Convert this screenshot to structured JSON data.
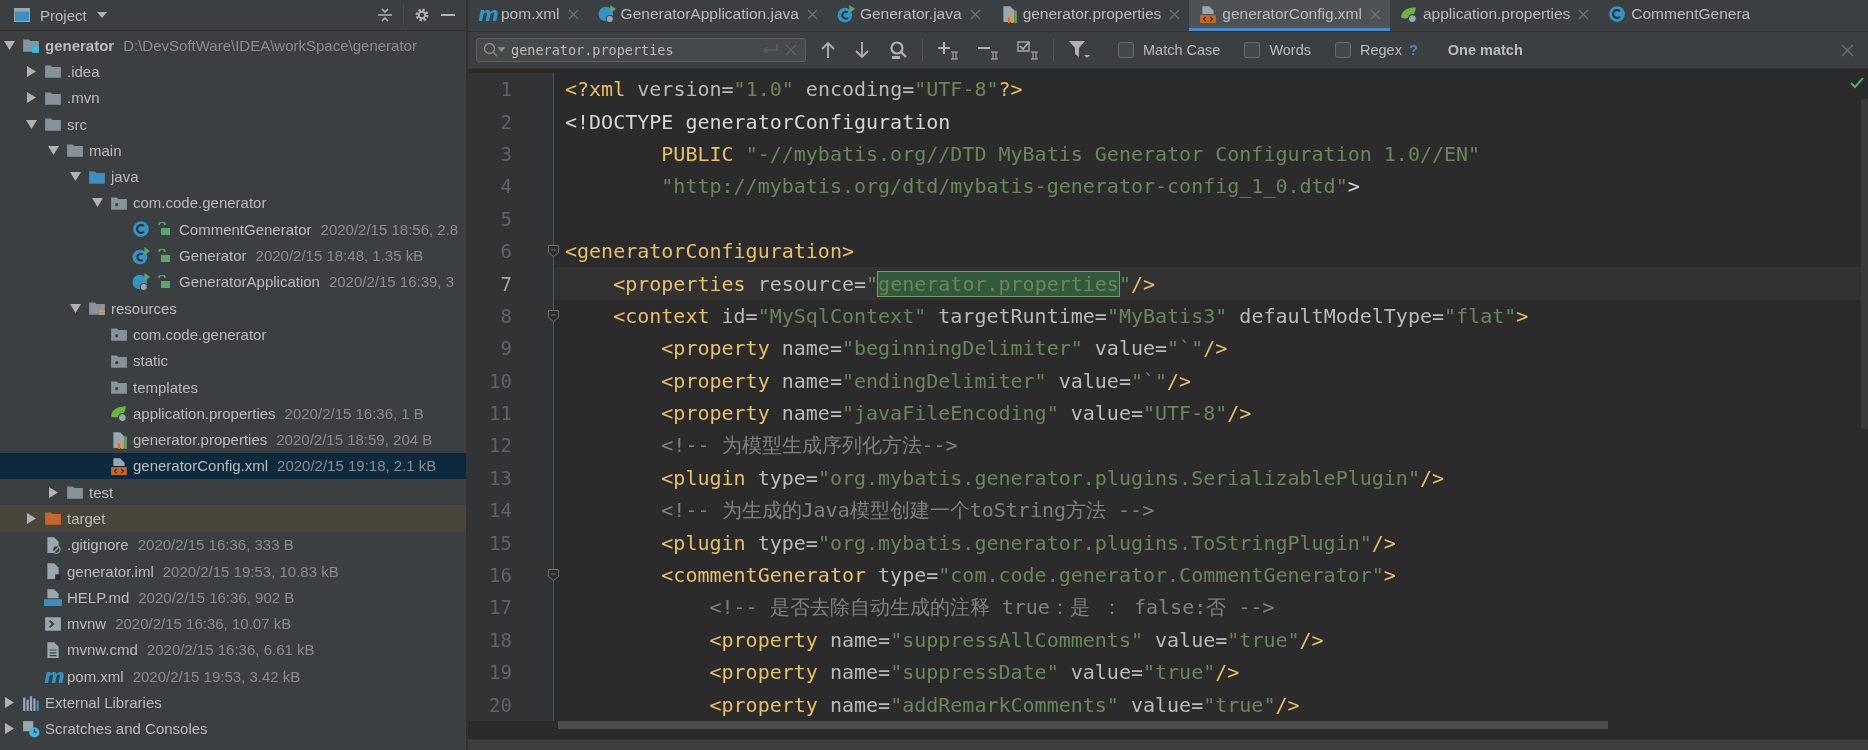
{
  "project_panel": {
    "title": "Project",
    "tree": [
      {
        "name": "generator",
        "meta": "D:\\DevSoftWare\\IDEA\\workSpace\\generator",
        "kind": "module",
        "expanded": true,
        "selected": false,
        "children": [
          {
            "name": ".idea",
            "kind": "folder",
            "expanded": false,
            "selected": false
          },
          {
            "name": ".mvn",
            "kind": "folder",
            "expanded": false,
            "selected": false
          },
          {
            "name": "src",
            "kind": "folder",
            "expanded": true,
            "selected": false,
            "children": [
              {
                "name": "main",
                "kind": "folder",
                "expanded": true,
                "selected": false,
                "children": [
                  {
                    "name": "java",
                    "kind": "source-folder",
                    "expanded": true,
                    "selected": false,
                    "children": [
                      {
                        "name": "com.code.generator",
                        "kind": "package",
                        "expanded": true,
                        "selected": false,
                        "children": [
                          {
                            "name": "CommentGenerator",
                            "meta": "2020/2/15 18:56, 2.8",
                            "kind": "class",
                            "lock": true,
                            "selected": false
                          },
                          {
                            "name": "Generator",
                            "meta": "2020/2/15 18:48, 1.35 kB",
                            "kind": "class-runnable",
                            "lock": true,
                            "selected": false
                          },
                          {
                            "name": "GeneratorApplication",
                            "meta": "2020/2/15 16:39, 3",
                            "kind": "class-spring",
                            "lock": true,
                            "selected": false
                          }
                        ]
                      }
                    ]
                  },
                  {
                    "name": "resources",
                    "kind": "resources-folder",
                    "expanded": true,
                    "selected": false,
                    "children": [
                      {
                        "name": "com.code.generator",
                        "kind": "package",
                        "selected": false
                      },
                      {
                        "name": "static",
                        "kind": "package",
                        "selected": false
                      },
                      {
                        "name": "templates",
                        "kind": "package",
                        "selected": false
                      },
                      {
                        "name": "application.properties",
                        "meta": "2020/2/15 16:36, 1 B",
                        "kind": "spring-properties",
                        "selected": false
                      },
                      {
                        "name": "generator.properties",
                        "meta": "2020/2/15 18:59, 204 B",
                        "kind": "properties",
                        "selected": false
                      },
                      {
                        "name": "generatorConfig.xml",
                        "meta": "2020/2/15 19:18, 2.1 kB",
                        "kind": "xml",
                        "selected": true
                      }
                    ]
                  }
                ]
              },
              {
                "name": "test",
                "kind": "folder",
                "expanded": false,
                "selected": false
              }
            ]
          },
          {
            "name": "target",
            "kind": "excluded-folder",
            "expanded": false,
            "selected": false
          },
          {
            "name": ".gitignore",
            "meta": "2020/2/15 16:36, 333 B",
            "kind": "gitignore",
            "selected": false
          },
          {
            "name": "generator.iml",
            "meta": "2020/2/15 19:53, 10.83 kB",
            "kind": "iml",
            "selected": false
          },
          {
            "name": "HELP.md",
            "meta": "2020/2/15 16:36, 902 B",
            "kind": "markdown",
            "selected": false
          },
          {
            "name": "mvnw",
            "meta": "2020/2/15 16:36, 10.07 kB",
            "kind": "shell",
            "selected": false
          },
          {
            "name": "mvnw.cmd",
            "meta": "2020/2/15 16:36, 6.61 kB",
            "kind": "text-file",
            "selected": false
          },
          {
            "name": "pom.xml",
            "meta": "2020/2/15 19:53, 3.42 kB",
            "kind": "maven",
            "icon_text": "m",
            "selected": false
          }
        ]
      },
      {
        "name": "External Libraries",
        "kind": "libraries",
        "expanded": false,
        "selected": false
      },
      {
        "name": "Scratches and Consoles",
        "kind": "scratches",
        "expanded": false,
        "selected": false
      }
    ]
  },
  "editor": {
    "tabs": [
      {
        "label": "pom.xml",
        "kind": "maven",
        "icon_text": "m",
        "selected": false,
        "closable": true
      },
      {
        "label": "GeneratorApplication.java",
        "kind": "class-spring",
        "selected": false,
        "closable": true
      },
      {
        "label": "Generator.java",
        "kind": "class-runnable",
        "selected": false,
        "closable": true
      },
      {
        "label": "generator.properties",
        "kind": "properties",
        "selected": false,
        "closable": true
      },
      {
        "label": "generatorConfig.xml",
        "kind": "xml",
        "selected": true,
        "closable": true
      },
      {
        "label": "application.properties",
        "kind": "spring-properties",
        "selected": false,
        "closable": true
      },
      {
        "label": "CommentGenera",
        "kind": "class",
        "selected": false,
        "closable": false
      }
    ],
    "search": {
      "value": "generator.properties",
      "options": [
        {
          "label": "Match Case",
          "checked": false
        },
        {
          "label": "Words",
          "checked": false
        },
        {
          "label": "Regex",
          "checked": false
        }
      ],
      "help": "?",
      "status": "One match"
    },
    "lines": [
      {
        "number": "1",
        "fold": false,
        "current": false,
        "tokens": [
          {
            "kind": "tag",
            "text": "<?xml"
          },
          {
            "kind": "attr",
            "text": " version="
          },
          {
            "kind": "string",
            "text": "\"1.0\""
          },
          {
            "kind": "attr",
            "text": " encoding="
          },
          {
            "kind": "string",
            "text": "\"UTF-8\""
          },
          {
            "kind": "tag",
            "text": "?>"
          }
        ]
      },
      {
        "number": "2",
        "fold": false,
        "current": false,
        "tokens": [
          {
            "kind": "plain",
            "text": "<!DOCTYPE generatorConfiguration"
          }
        ]
      },
      {
        "number": "3",
        "fold": false,
        "current": false,
        "tokens": [
          {
            "kind": "tag",
            "text": "        PUBLIC "
          },
          {
            "kind": "string",
            "text": "\"-//mybatis.org//DTD MyBatis Generator Configuration 1.0//EN\""
          }
        ]
      },
      {
        "number": "4",
        "fold": false,
        "current": false,
        "tokens": [
          {
            "kind": "string",
            "text": "        \"http://mybatis.org/dtd/mybatis-generator-config_1_0.dtd\""
          },
          {
            "kind": "plain",
            "text": ">"
          }
        ]
      },
      {
        "number": "5",
        "fold": false,
        "current": false
      },
      {
        "number": "6",
        "fold": true,
        "current": false,
        "tokens": [
          {
            "kind": "tag",
            "text": "<generatorConfiguration>"
          }
        ]
      },
      {
        "number": "7",
        "fold": false,
        "current": true,
        "tokens": [
          {
            "kind": "tag",
            "text": "    <properties"
          },
          {
            "kind": "attr",
            "text": " resource="
          },
          {
            "kind": "string",
            "text": "\""
          },
          {
            "kind": "match",
            "text": "generator.properties"
          },
          {
            "kind": "string",
            "text": "\""
          },
          {
            "kind": "tag",
            "text": "/>"
          }
        ]
      },
      {
        "number": "8",
        "fold": true,
        "current": false,
        "tokens": [
          {
            "kind": "tag",
            "text": "    <context"
          },
          {
            "kind": "attr",
            "text": " id="
          },
          {
            "kind": "string",
            "text": "\"MySqlContext\""
          },
          {
            "kind": "attr",
            "text": " targetRuntime="
          },
          {
            "kind": "string",
            "text": "\"MyBatis3\""
          },
          {
            "kind": "attr",
            "text": " defaultModelType="
          },
          {
            "kind": "string",
            "text": "\"flat\""
          },
          {
            "kind": "tag",
            "text": ">"
          }
        ]
      },
      {
        "number": "9",
        "fold": false,
        "current": false,
        "tokens": [
          {
            "kind": "tag",
            "text": "        <property"
          },
          {
            "kind": "attr",
            "text": " name="
          },
          {
            "kind": "string",
            "text": "\"beginningDelimiter\""
          },
          {
            "kind": "attr",
            "text": " value="
          },
          {
            "kind": "string",
            "text": "\"`\""
          },
          {
            "kind": "tag",
            "text": "/>"
          }
        ]
      },
      {
        "number": "10",
        "fold": false,
        "current": false,
        "tokens": [
          {
            "kind": "tag",
            "text": "        <property"
          },
          {
            "kind": "attr",
            "text": " name="
          },
          {
            "kind": "string",
            "text": "\"endingDelimiter\""
          },
          {
            "kind": "attr",
            "text": " value="
          },
          {
            "kind": "string",
            "text": "\"`\""
          },
          {
            "kind": "tag",
            "text": "/>"
          }
        ]
      },
      {
        "number": "11",
        "fold": false,
        "current": false,
        "tokens": [
          {
            "kind": "tag",
            "text": "        <property"
          },
          {
            "kind": "attr",
            "text": " name="
          },
          {
            "kind": "string",
            "text": "\"javaFileEncoding\""
          },
          {
            "kind": "attr",
            "text": " value="
          },
          {
            "kind": "string",
            "text": "\"UTF-8\""
          },
          {
            "kind": "tag",
            "text": "/>"
          }
        ]
      },
      {
        "number": "12",
        "fold": false,
        "current": false,
        "tokens": [
          {
            "kind": "comment",
            "text": "        <!-- 为模型生成序列化方法-->"
          }
        ]
      },
      {
        "number": "13",
        "fold": false,
        "current": false,
        "tokens": [
          {
            "kind": "tag",
            "text": "        <plugin"
          },
          {
            "kind": "attr",
            "text": " type="
          },
          {
            "kind": "string",
            "text": "\"org.mybatis.generator.plugins.SerializablePlugin\""
          },
          {
            "kind": "tag",
            "text": "/>"
          }
        ]
      },
      {
        "number": "14",
        "fold": false,
        "current": false,
        "tokens": [
          {
            "kind": "comment",
            "text": "        <!-- 为生成的Java模型创建一个toString方法 -->"
          }
        ]
      },
      {
        "number": "15",
        "fold": false,
        "current": false,
        "tokens": [
          {
            "kind": "tag",
            "text": "        <plugin"
          },
          {
            "kind": "attr",
            "text": " type="
          },
          {
            "kind": "string",
            "text": "\"org.mybatis.generator.plugins.ToStringPlugin\""
          },
          {
            "kind": "tag",
            "text": "/>"
          }
        ]
      },
      {
        "number": "16",
        "fold": true,
        "current": false,
        "tokens": [
          {
            "kind": "tag",
            "text": "        <commentGenerator"
          },
          {
            "kind": "attr",
            "text": " type="
          },
          {
            "kind": "string",
            "text": "\"com.code.generator.CommentGenerator\""
          },
          {
            "kind": "tag",
            "text": ">"
          }
        ]
      },
      {
        "number": "17",
        "fold": false,
        "current": false,
        "tokens": [
          {
            "kind": "comment",
            "text": "            <!-- 是否去除自动生成的注释 true：是 ： false:否 -->"
          }
        ]
      },
      {
        "number": "18",
        "fold": false,
        "current": false,
        "tokens": [
          {
            "kind": "tag",
            "text": "            <property"
          },
          {
            "kind": "attr",
            "text": " name="
          },
          {
            "kind": "string",
            "text": "\"suppressAllComments\""
          },
          {
            "kind": "attr",
            "text": " value="
          },
          {
            "kind": "string",
            "text": "\"true\""
          },
          {
            "kind": "tag",
            "text": "/>"
          }
        ]
      },
      {
        "number": "19",
        "fold": false,
        "current": false,
        "tokens": [
          {
            "kind": "tag",
            "text": "            <property"
          },
          {
            "kind": "attr",
            "text": " name="
          },
          {
            "kind": "string",
            "text": "\"suppressDate\""
          },
          {
            "kind": "attr",
            "text": " value="
          },
          {
            "kind": "string",
            "text": "\"true\""
          },
          {
            "kind": "tag",
            "text": "/>"
          }
        ]
      },
      {
        "number": "20",
        "fold": false,
        "current": false,
        "tokens": [
          {
            "kind": "tag",
            "text": "            <property"
          },
          {
            "kind": "attr",
            "text": " name="
          },
          {
            "kind": "string",
            "text": "\"addRemarkComments\""
          },
          {
            "kind": "attr",
            "text": " value="
          },
          {
            "kind": "string",
            "text": "\"true\""
          },
          {
            "kind": "tag",
            "text": "/>"
          }
        ]
      }
    ]
  }
}
